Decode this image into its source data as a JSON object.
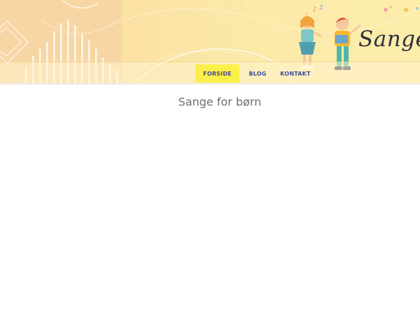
{
  "header": {
    "logo_text": "Sange",
    "nav": [
      {
        "label": "FORSIDE",
        "active": true
      },
      {
        "label": "BLOG",
        "active": false
      },
      {
        "label": "KONTAKT",
        "active": false
      }
    ]
  },
  "main": {
    "title": "Sange for børn"
  },
  "colors": {
    "nav_active_bg": "#fbf04a",
    "nav_text": "#3d4f9e",
    "title_text": "#6f6f6f",
    "header_bg": "#fbe9a8"
  }
}
